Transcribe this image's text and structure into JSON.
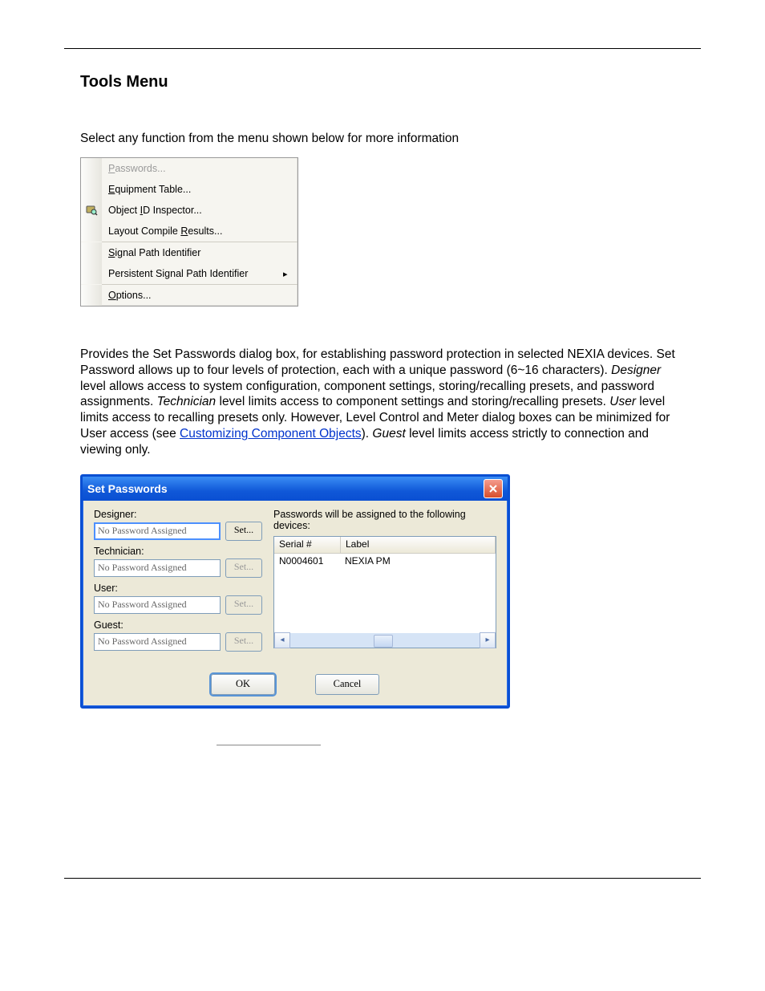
{
  "heading": "Tools Menu",
  "intro": "Select any function from the menu shown below for more information",
  "menu": {
    "items": [
      {
        "label": "Passwords...",
        "disabled": true,
        "icon": false,
        "underlineIdx": 0
      },
      {
        "label": "Equipment Table...",
        "disabled": false,
        "icon": false,
        "underlineIdx": 0
      },
      {
        "label": "Object ID Inspector...",
        "disabled": false,
        "icon": true,
        "underlineIdx": 7
      },
      {
        "label": "Layout Compile Results...",
        "disabled": false,
        "icon": false,
        "underlineIdx": 15
      }
    ],
    "sep1": true,
    "group2": [
      {
        "label": "Signal Path Identifier",
        "underlineIdx": 0,
        "submenu": false
      },
      {
        "label": "Persistent Signal Path Identifier",
        "underlineIdx": -1,
        "submenu": true
      }
    ],
    "sep2": true,
    "group3": [
      {
        "label": "Options...",
        "underlineIdx": 0
      }
    ]
  },
  "para": {
    "p1a": "Provides the Set Passwords dialog box, for establishing password protection in selected NEXIA devices. Set Password allows up to four levels of protection, each with a unique password (6~16 characters). ",
    "lvlDesigner": "Designer",
    "p1b": " level allows access to system configuration, component settings, storing/recalling presets, and password assignments. ",
    "lvlTechnician": "Technician",
    "p1c": " level limits access to component settings and storing/recalling presets. ",
    "lvlUser": "User",
    "p1d": " level limits access to recalling presets only. However, Level Control and Meter dialog boxes can be minimized for User access (see ",
    "link": "Customizing Component Objects",
    "p1e": "). ",
    "lvlGuest": "Guest",
    "p1f": " level limits access strictly to connection and viewing only."
  },
  "dialog": {
    "title": "Set Passwords",
    "close": "X",
    "levels": [
      {
        "label": "Designer:",
        "value": "No Password Assigned",
        "selected": true,
        "setEnabled": true
      },
      {
        "label": "Technician:",
        "value": "No Password Assigned",
        "selected": false,
        "setEnabled": false
      },
      {
        "label": "User:",
        "value": "No Password Assigned",
        "selected": false,
        "setEnabled": false
      },
      {
        "label": "Guest:",
        "value": "No Password Assigned",
        "selected": false,
        "setEnabled": false
      }
    ],
    "setLabel": "Set...",
    "devicesCaption": "Passwords will be assigned to the following devices:",
    "columns": {
      "serial": "Serial #",
      "label": "Label"
    },
    "rows": [
      {
        "serial": "N0004601",
        "label": "NEXIA PM"
      }
    ],
    "ok": "OK",
    "cancel": "Cancel"
  }
}
